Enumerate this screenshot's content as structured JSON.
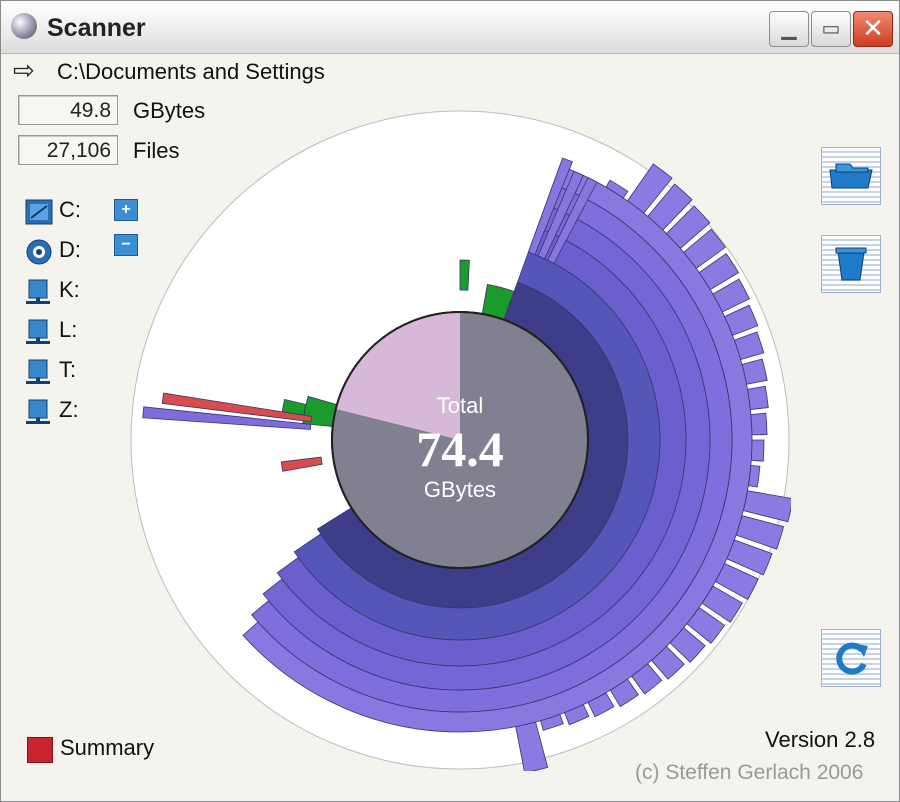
{
  "window": {
    "title": "Scanner"
  },
  "path": {
    "text": "C:\\Documents and Settings"
  },
  "stats": [
    {
      "value": "49.8",
      "label": "GBytes"
    },
    {
      "value": "27,106",
      "label": "Files"
    }
  ],
  "drives": [
    {
      "label": "C:",
      "icon": "hard-disk-icon"
    },
    {
      "label": "D:",
      "icon": "cd-drive-icon"
    },
    {
      "label": "K:",
      "icon": "network-drive-icon"
    },
    {
      "label": "L:",
      "icon": "network-drive-icon"
    },
    {
      "label": "T:",
      "icon": "network-drive-icon"
    },
    {
      "label": "Z:",
      "icon": "network-drive-icon"
    }
  ],
  "zoom": {
    "plus": "+",
    "minus": "−"
  },
  "chart_data": {
    "type": "sunburst",
    "center": {
      "line1": "Total",
      "value": "74.4",
      "unit": "GBytes"
    },
    "colors": {
      "ring": "#7b6ad8",
      "inner_ring": "#3d3d8a",
      "green": "#1a9b2b",
      "red": "#d94c4c",
      "center_used": "#808090",
      "center_free": "#d7b8d8"
    }
  },
  "side_buttons": [
    {
      "name": "explore-button",
      "icon": "folder-open-icon"
    },
    {
      "name": "recycle-button",
      "icon": "recycle-bin-icon"
    },
    {
      "name": "refresh-button",
      "icon": "refresh-icon"
    }
  ],
  "summary": {
    "label": "Summary"
  },
  "footer": {
    "version": "Version 2.8",
    "copyright": "(c) Steffen Gerlach 2006"
  }
}
